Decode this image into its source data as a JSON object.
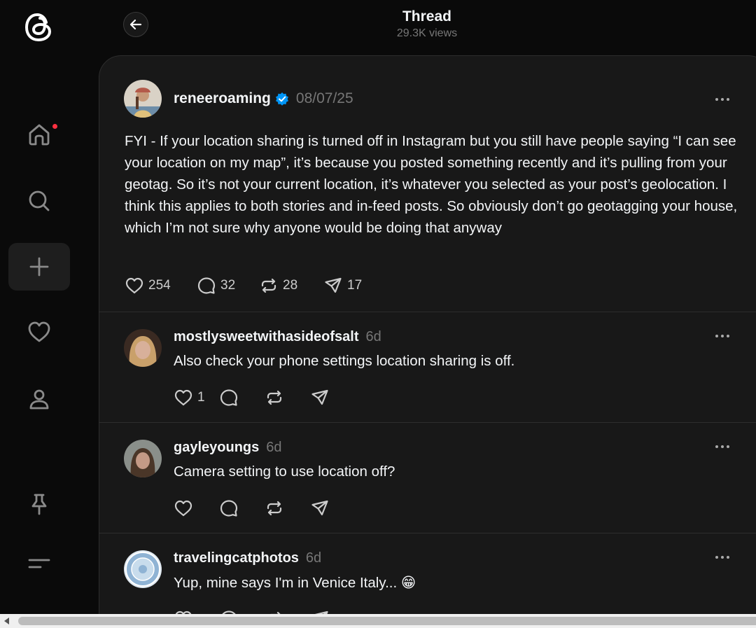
{
  "header": {
    "title": "Thread",
    "views": "29.3K views"
  },
  "sidebar": {
    "items": [
      "threads-logo",
      "home-icon",
      "search-icon",
      "create-icon",
      "heart-icon",
      "profile-icon",
      "pin-icon",
      "menu-icon"
    ],
    "notification_dot_color": "#ff3040"
  },
  "main_post": {
    "username": "reneeroaming",
    "verified": true,
    "date": "08/07/25",
    "text": "FYI - If your location sharing is turned off in Instagram but you still have people saying “I can see your location on my map”, it’s because you posted something recently and it’s pulling from your geotag. So it’s not your current location, it’s whatever you selected as your post’s geolocation. I think this applies to both stories and in-feed posts. So obviously don’t go geotagging your house, which I’m not sure why anyone would be doing that anyway",
    "likes": "254",
    "comments": "32",
    "reposts": "28",
    "shares": "17"
  },
  "replies": [
    {
      "username": "mostlysweetwithasideofsalt",
      "time": "6d",
      "text": "Also check your phone settings location sharing is off.",
      "likes": "1"
    },
    {
      "username": "gayleyoungs",
      "time": "6d",
      "text": "Camera setting to use location off?",
      "likes": ""
    },
    {
      "username": "travelingcatphotos",
      "time": "6d",
      "text": "Yup, mine says I'm in Venice Italy...",
      "emoji": "😁",
      "likes": ""
    }
  ],
  "colors": {
    "background": "#0a0a0a",
    "panel": "#181818",
    "verified": "#0095f6",
    "muted": "#777777"
  }
}
